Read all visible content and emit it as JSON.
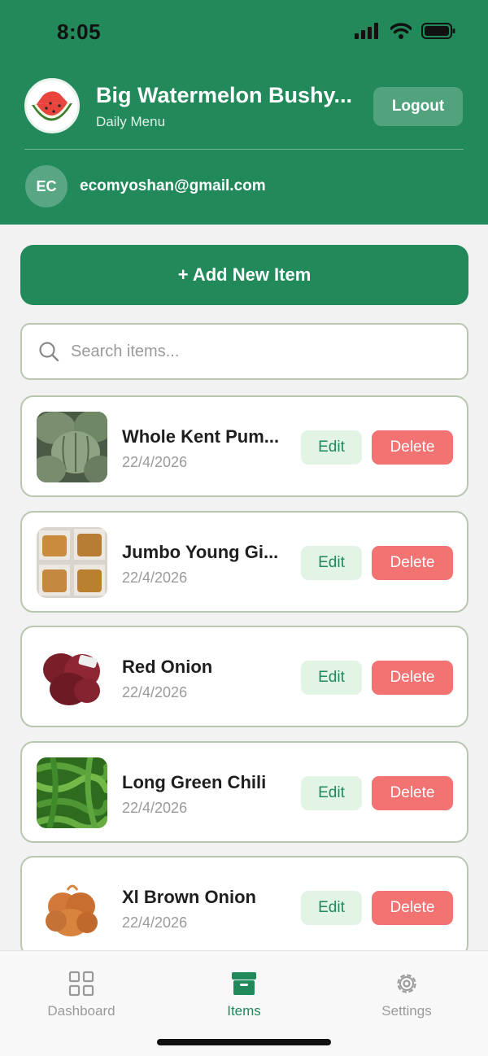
{
  "status_bar": {
    "time": "8:05"
  },
  "header": {
    "store_name": "Big Watermelon Bushy...",
    "subtitle": "Daily Menu",
    "logout_label": "Logout",
    "avatar_initials": "EC",
    "email": "ecomyoshan@gmail.com"
  },
  "main": {
    "add_label": "+ Add New Item",
    "search_placeholder": "Search items...",
    "items": [
      {
        "name": "Whole Kent Pum...",
        "date": "22/4/2026",
        "edit_label": "Edit",
        "delete_label": "Delete"
      },
      {
        "name": "Jumbo Young Gi...",
        "date": "22/4/2026",
        "edit_label": "Edit",
        "delete_label": "Delete"
      },
      {
        "name": "Red Onion",
        "date": "22/4/2026",
        "edit_label": "Edit",
        "delete_label": "Delete"
      },
      {
        "name": "Long Green Chili",
        "date": "22/4/2026",
        "edit_label": "Edit",
        "delete_label": "Delete"
      },
      {
        "name": "Xl Brown Onion",
        "date": "22/4/2026",
        "edit_label": "Edit",
        "delete_label": "Delete"
      }
    ]
  },
  "tabbar": {
    "tabs": [
      {
        "label": "Dashboard",
        "icon": "grid-icon"
      },
      {
        "label": "Items",
        "icon": "archive-box-icon"
      },
      {
        "label": "Settings",
        "icon": "gear-icon"
      }
    ],
    "active": "Items"
  },
  "colors": {
    "primary": "#21895a",
    "danger": "#f37272",
    "edit_bg": "#e2f4e4",
    "background": "#f2f2f2"
  }
}
